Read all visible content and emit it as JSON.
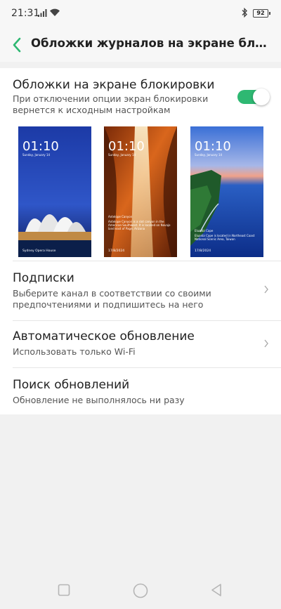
{
  "status": {
    "time": "21:31",
    "battery": "92"
  },
  "header": {
    "title": "Обложки журналов на экране блоки..."
  },
  "lockscreen": {
    "title": "Обложки на экране блокировки",
    "subtitle_line1": "При отключении опции экран блокировки",
    "subtitle_line2": "вернется к исходным настройкам",
    "enabled": true,
    "accent_color": "#2eb872"
  },
  "thumbnails": [
    {
      "time": "01:10",
      "date": "Sunday, January 14",
      "caption": "Sydney Opera House"
    },
    {
      "time": "01:10",
      "date": "Sunday, January 14",
      "caption": "Antelope Canyon",
      "description": "Antelope Canyon is a slot canyon in the American Southwest. It is located on Navajo land east of Page, Arizona",
      "counter": "17/8/2024"
    },
    {
      "time": "01:10",
      "date": "Sunday, January 14",
      "caption": "Eluanbi Cape",
      "description": "Eluanbi Cape is located in Northeast Coast National Scenic Area, Taiwan",
      "counter": "17/8/2024"
    }
  ],
  "subscriptions": {
    "title": "Подписки",
    "subtitle_line1": "Выберите канал в соответствии со своими",
    "subtitle_line2": "предпочтениями и подпишитесь на него"
  },
  "auto_update": {
    "title": "Автоматическое обновление",
    "subtitle": "Использовать только Wi-Fi"
  },
  "check_updates": {
    "title": "Поиск обновлений",
    "subtitle": "Обновление не выполнялось ни разу"
  },
  "navbar": {
    "icons": [
      "square-icon",
      "circle-icon",
      "triangle-back-icon"
    ]
  }
}
